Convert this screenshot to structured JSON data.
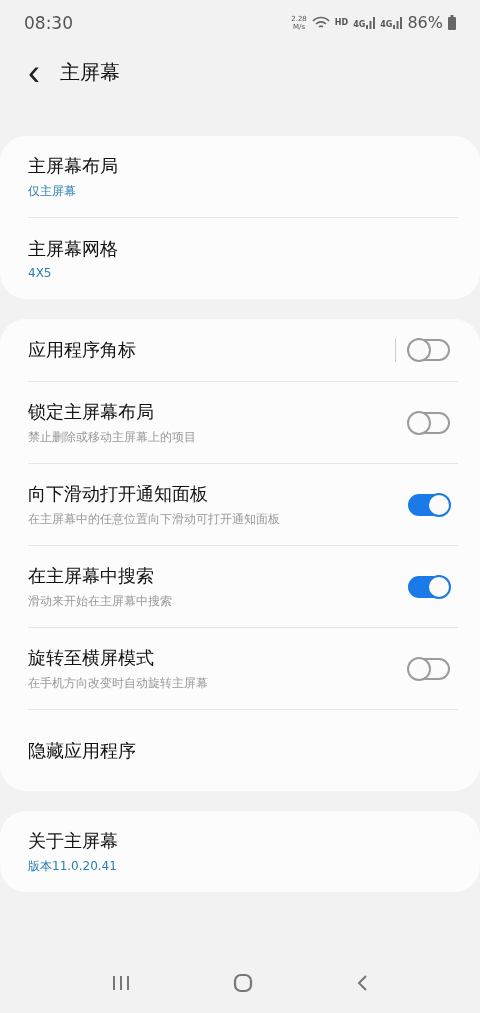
{
  "status_bar": {
    "time": "08:30",
    "speed_value": "2.28",
    "speed_unit": "M/s",
    "hd": "HD",
    "networks": [
      "4G",
      "4G"
    ],
    "battery": "86%"
  },
  "header": {
    "back": "‹",
    "title": "主屏幕"
  },
  "groups": [
    {
      "items": [
        {
          "kind": "link",
          "title": "主屏幕布局",
          "value": "仅主屏幕"
        },
        {
          "kind": "link",
          "title": "主屏幕网格",
          "value": "4X5"
        }
      ]
    },
    {
      "items": [
        {
          "kind": "toggle",
          "title": "应用程序角标",
          "on": false,
          "separator": true
        },
        {
          "kind": "toggle",
          "title": "锁定主屏幕布局",
          "subtitle": "禁止删除或移动主屏幕上的项目",
          "on": false
        },
        {
          "kind": "toggle",
          "title": "向下滑动打开通知面板",
          "subtitle": "在主屏幕中的任意位置向下滑动可打开通知面板",
          "on": true
        },
        {
          "kind": "toggle",
          "title": "在主屏幕中搜索",
          "subtitle": "滑动来开始在主屏幕中搜索",
          "on": true
        },
        {
          "kind": "toggle",
          "title": "旋转至横屏模式",
          "subtitle": "在手机方向改变时自动旋转主屏幕",
          "on": false
        },
        {
          "kind": "link",
          "title": "隐藏应用程序"
        }
      ]
    },
    {
      "items": [
        {
          "kind": "link",
          "title": "关于主屏幕",
          "value": "版本11.0.20.41"
        }
      ]
    }
  ]
}
